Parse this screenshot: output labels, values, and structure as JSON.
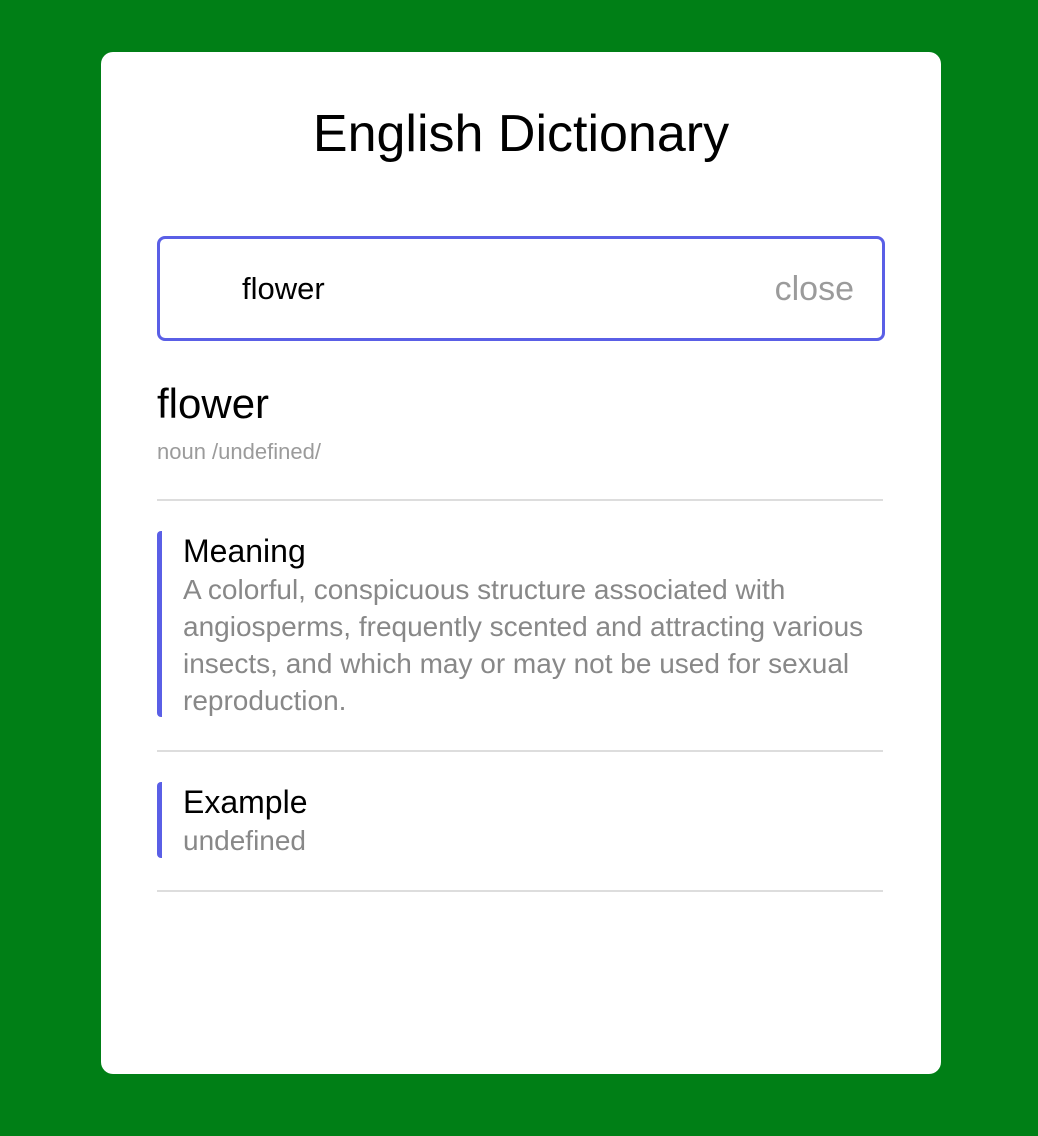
{
  "app": {
    "title": "English Dictionary"
  },
  "search": {
    "value": "flower",
    "close_label": "close"
  },
  "result": {
    "word": "flower",
    "meta": "noun /undefined/",
    "meaning": {
      "heading": "Meaning",
      "text": "A colorful, conspicuous structure associated with angiosperms, frequently scented and attracting various insects, and which may or may not be used for sexual reproduction."
    },
    "example": {
      "heading": "Example",
      "text": "undefined"
    }
  },
  "colors": {
    "background": "#007f16",
    "card": "#ffffff",
    "accent": "#5a5fe6",
    "muted_text": "#888888"
  }
}
